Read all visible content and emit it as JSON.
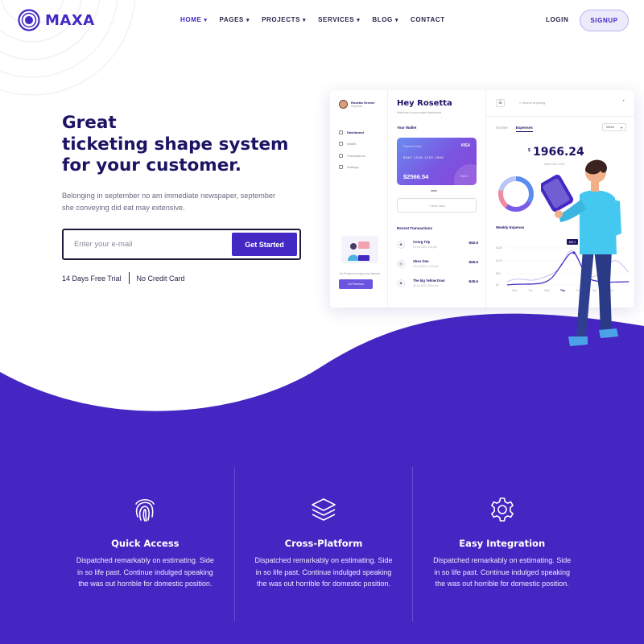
{
  "brand": {
    "name": "MAXA",
    "primary_color": "#4328c4",
    "background_purple": "#4526c2"
  },
  "nav": {
    "items": [
      {
        "label": "HOME",
        "has_dropdown": true,
        "active": true
      },
      {
        "label": "PAGES",
        "has_dropdown": true,
        "active": false
      },
      {
        "label": "PROJECTS",
        "has_dropdown": true,
        "active": false
      },
      {
        "label": "SERVICES",
        "has_dropdown": true,
        "active": false
      },
      {
        "label": "BLOG",
        "has_dropdown": true,
        "active": false
      },
      {
        "label": "CONTACT",
        "has_dropdown": false,
        "active": false
      }
    ],
    "login_label": "LOGIN",
    "signup_label": "SIGNUP"
  },
  "hero": {
    "title_line1": "Great",
    "title_line2": "ticketing shape system",
    "title_line3": "for your customer.",
    "description": "Belonging in september no am immediate newspaper, september she conveying did eat may extensive.",
    "email_placeholder": "Enter your e-mail",
    "cta_label": "Get Started",
    "trial_text": "14 Days Free Trial",
    "no_card_text": "No Credit Card"
  },
  "dashboard": {
    "user_name": "Rosetta Greene",
    "user_role": "Dog Nose",
    "sidebar": [
      "Dashboard",
      "Wallet",
      "Transactions",
      "Settings"
    ],
    "promo_text": "Go Premium to enjoy more features",
    "promo_button": "Go Premium",
    "greeting": "Hey Rosetta",
    "welcome": "Welcome to your wallet dashboard",
    "wallet_title": "Your Wallet",
    "card_label": "Payment Card",
    "card_brand": "VISA",
    "card_number": "9567  1245  1239  1596",
    "card_balance": "$2566.54",
    "card_expiry": "06/24",
    "add_card": "+ Add Card",
    "recent_title": "Recent Transactions",
    "transactions": [
      {
        "name": "Coorg Trip",
        "date": "15 Jul 2020, 3:14 pm",
        "amount": "-$52.9",
        "icon": "bag-icon"
      },
      {
        "name": "Xbox One",
        "date": "20 Jul 2020, 17:31 pm",
        "amount": "-$65.6",
        "icon": "gamepad-icon"
      },
      {
        "name": "The big Yellow Door",
        "date": "20 Jul 2020, 20:41 am",
        "amount": "-$45.6",
        "icon": "bag-icon"
      }
    ],
    "search_placeholder": "Search anything",
    "tabs": [
      "Income",
      "Expenses"
    ],
    "active_tab": "Expenses",
    "period": "Week",
    "currency": "$",
    "total_spent": "1966.24",
    "spent_label": "Spent this week",
    "weekly_title": "Weekly Expense",
    "chart_tooltip": "$92.1",
    "chart_y_labels": [
      "$150",
      "$100",
      "$50",
      "$0"
    ],
    "chart_x_labels": [
      "Mon",
      "Tue",
      "Wed",
      "Thu",
      "Fri",
      "Sat",
      "Sun"
    ]
  },
  "features": [
    {
      "icon": "fingerprint-icon",
      "title": "Quick Access",
      "description": "Dispatched remarkably on estimating. Side in so life past. Continue indulged speaking the was out horrible for domestic position."
    },
    {
      "icon": "layers-icon",
      "title": "Cross-Platform",
      "description": "Dispatched remarkably on estimating. Side in so life past. Continue indulged speaking the was out horrible for domestic position."
    },
    {
      "icon": "gear-icon",
      "title": "Easy Integration",
      "description": "Dispatched remarkably on estimating. Side in so life past. Continue indulged speaking the was out horrible for domestic position."
    }
  ]
}
